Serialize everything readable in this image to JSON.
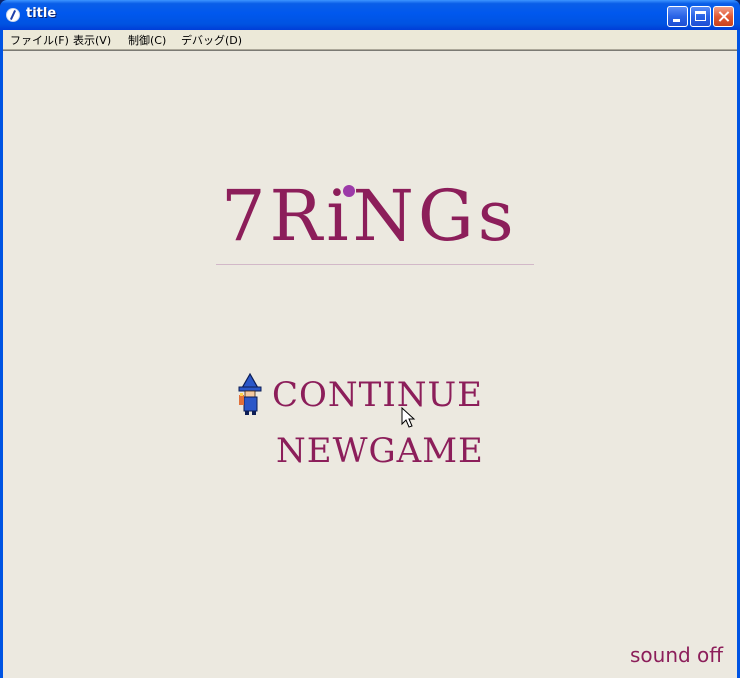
{
  "window": {
    "title": "title",
    "icon": "app-icon"
  },
  "menubar": {
    "items": [
      {
        "label": "ファイル(F)"
      },
      {
        "label": "表示(V)"
      },
      {
        "label": "制御(C)"
      },
      {
        "label": "デバッグ(D)"
      }
    ]
  },
  "game": {
    "title": "7RiNGs",
    "menu": {
      "continue_label": "CONTINUE",
      "newgame_label": "NEWGAME",
      "selected": "CONTINUE",
      "selector_icon": "wizard-sprite-icon"
    },
    "sound_label": "sound off"
  },
  "colors": {
    "title_accent": "#8c1e5a",
    "dot_accent": "#9c3aa8",
    "background": "#ece9e0",
    "titlebar": "#0058ee"
  }
}
